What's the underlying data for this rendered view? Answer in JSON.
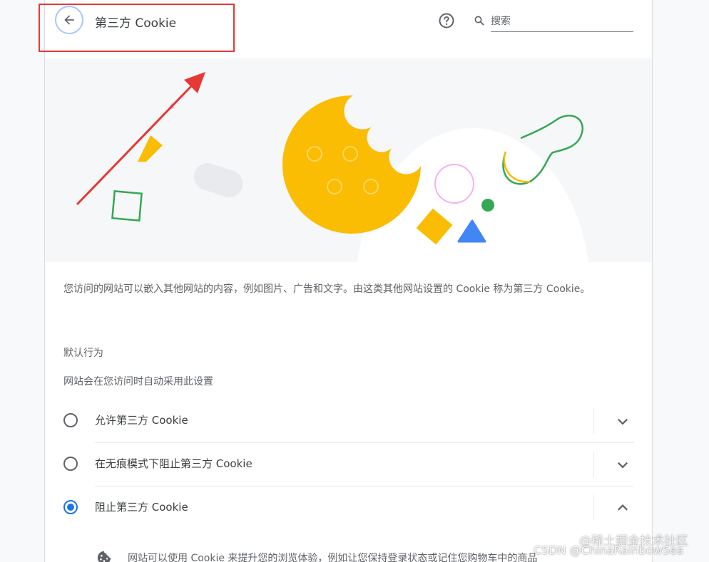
{
  "header": {
    "title": "第三方 Cookie",
    "back_icon": "arrow-back-icon",
    "help_icon": "help-circle-icon",
    "search": {
      "placeholder": "搜索",
      "value": "",
      "icon": "search-icon"
    }
  },
  "description": "您访问的网站可以嵌入其他网站的内容，例如图片、广告和文字。由这类其他网站设置的 Cookie 称为第三方 Cookie。",
  "default_behavior": {
    "heading": "默认行为",
    "subheading": "网站会在您访问时自动采用此设置",
    "options": [
      {
        "label": "允许第三方 Cookie",
        "checked": false,
        "expand_icon": "chevron-down-icon"
      },
      {
        "label": "在无痕模式下阻止第三方 Cookie",
        "checked": false,
        "expand_icon": "chevron-down-icon"
      },
      {
        "label": "阻止第三方 Cookie",
        "checked": true,
        "expand_icon": "chevron-up-icon"
      }
    ]
  },
  "expanded_detail": {
    "icon": "cookie-icon",
    "text": "网站可以使用 Cookie 来提升您的浏览体验，例如让您保持登录状态或记住您购物车中的商品"
  },
  "watermarks": {
    "line1": "@稀土掘金技术社区",
    "line2": "CSDN @ChinaRainbowSea"
  },
  "colors": {
    "accent": "#1a73e8",
    "cookie_yellow": "#fbbc04",
    "annotation_red": "#e53935",
    "green": "#34a853"
  }
}
